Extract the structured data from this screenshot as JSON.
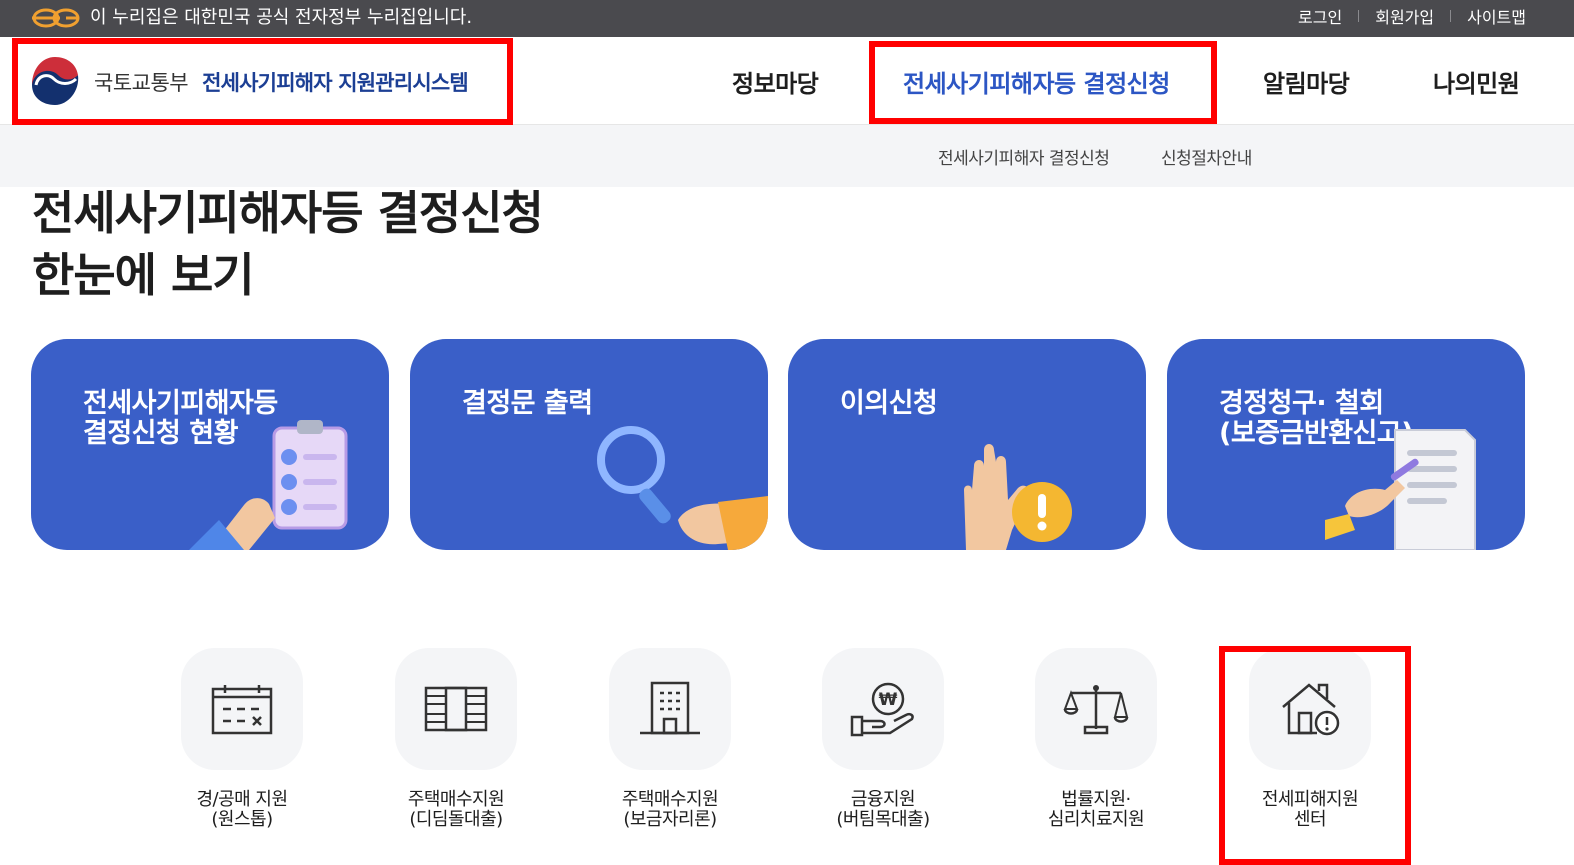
{
  "gov_banner": {
    "text": "이 누리집은 대한민국 공식 전자정부 누리집입니다.",
    "links": [
      "로그인",
      "회원가입",
      "사이트맵"
    ]
  },
  "header": {
    "ministry": "국토교통부",
    "system": "전세사기피해자 지원관리시스템",
    "nav": [
      "정보마당",
      "전세사기피해자등 결정신청",
      "알림마당",
      "나의민원"
    ],
    "active_nav": "전세사기피해자등 결정신청"
  },
  "submenu": [
    "전세사기피해자 결정신청",
    "신청절차안내"
  ],
  "page_title": {
    "line1": "전세사기피해자등 결정신청",
    "line2": "한눈에 보기"
  },
  "cards": [
    {
      "title": "전세사기피해자등\n결정신청 현황",
      "icon": "clipboard-checklist-icon"
    },
    {
      "title": "결정문 출력",
      "icon": "magnifier-icon"
    },
    {
      "title": "이의신청",
      "icon": "raised-hand-alert-icon"
    },
    {
      "title": "경정청구· 철회\n(보증금반환신고)",
      "icon": "document-writing-icon"
    }
  ],
  "quick_links": [
    {
      "line1": "경/공매 지원",
      "line2": "(원스톱)",
      "icon": "calendar-icon"
    },
    {
      "line1": "주택매수지원",
      "line2": "(디딤돌대출)",
      "icon": "money-icon"
    },
    {
      "line1": "주택매수지원",
      "line2": "(보금자리론)",
      "icon": "building-icon"
    },
    {
      "line1": "금융지원",
      "line2": "(버팀목대출)",
      "icon": "won-hand-icon"
    },
    {
      "line1": "법률지원·",
      "line2": "심리치료지원",
      "icon": "scale-icon"
    },
    {
      "line1": "전세피해지원",
      "line2": "센터",
      "icon": "house-alert-icon"
    }
  ],
  "colors": {
    "gov_bar": "#4a4a4e",
    "brand_blue": "#1c3f94",
    "active_nav": "#2c56c4",
    "card_blue": "#3a5fc8",
    "highlight": "#ff0000",
    "icon_tile": "#f4f5f7"
  }
}
